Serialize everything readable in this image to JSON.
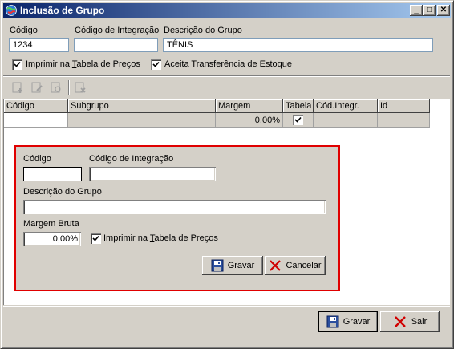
{
  "window": {
    "title": "Inclusão de Grupo",
    "controls": {
      "minimize": "_",
      "maximize": "□",
      "close": "✕"
    }
  },
  "form": {
    "codigo_label": "Código",
    "codigo_value": "1234",
    "integracao_label": "Código de Integração",
    "integracao_value": "",
    "descricao_label": "Descrição do Grupo",
    "descricao_value": "TÊNIS",
    "imprimir_label_pre": "Imprimir na ",
    "imprimir_label_u": "T",
    "imprimir_label_post": "abela de Preços",
    "imprimir_checked": true,
    "aceita_label": "Aceita Transferência de Estoque",
    "aceita_checked": true
  },
  "toolbar": {
    "icons": [
      "add-icon",
      "edit-icon",
      "copy-icon",
      "delete-icon"
    ]
  },
  "grid": {
    "columns": [
      "Código",
      "Subgrupo",
      "Margem",
      "Tabela",
      "Cód.Integr.",
      "Id"
    ],
    "rows": [
      {
        "codigo": "",
        "subgrupo": "",
        "margem": "0,00%",
        "tabela": true,
        "cod_integr": "",
        "id": ""
      }
    ]
  },
  "subform": {
    "codigo_label": "Código",
    "codigo_value": "",
    "integracao_label": "Código de Integração",
    "integracao_value": "",
    "descricao_label": "Descrição do Grupo",
    "descricao_value": "",
    "margem_label": "Margem Bruta",
    "margem_value": "0,00%",
    "imprimir_label_pre": "Imprimir na ",
    "imprimir_label_u": "T",
    "imprimir_label_post": "abela de Preços",
    "imprimir_checked": true,
    "gravar_label": "Gravar",
    "cancelar_label": "Cancelar"
  },
  "footer": {
    "gravar_label": "Gravar",
    "sair_label": "Sair"
  },
  "colors": {
    "title_start": "#0a246a",
    "title_end": "#a6caf0",
    "panel_border": "#e00000",
    "face": "#d4d0c8"
  }
}
